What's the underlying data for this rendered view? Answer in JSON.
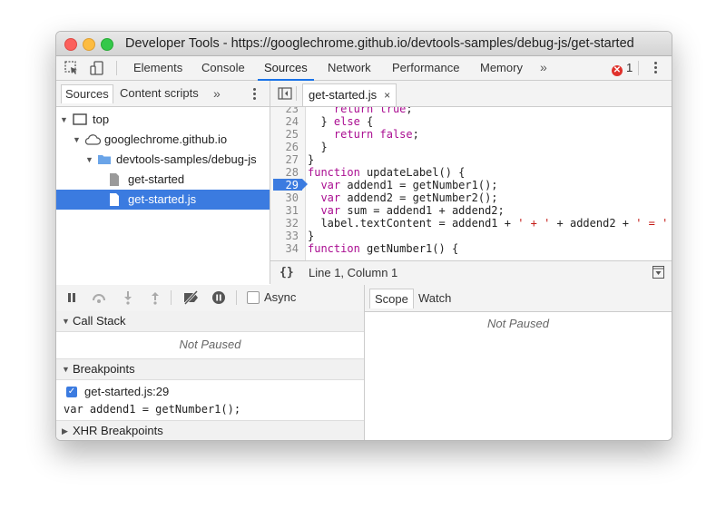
{
  "window": {
    "title": "Developer Tools - https://googlechrome.github.io/devtools-samples/debug-js/get-started"
  },
  "toolbar": {
    "inspect_icon": "inspect-element-icon",
    "device_icon": "device-toolbar-icon",
    "tabs": [
      "Elements",
      "Console",
      "Sources",
      "Network",
      "Performance",
      "Memory"
    ],
    "active_tab": "Sources",
    "more_tabs": "»",
    "error_count": "1",
    "error_glyph": "✕"
  },
  "navigator": {
    "tabs": [
      "Sources",
      "Content scripts"
    ],
    "more": "»",
    "tree": [
      {
        "label": "top",
        "icon": "frame-icon"
      },
      {
        "label": "googlechrome.github.io",
        "icon": "cloud-icon"
      },
      {
        "label": "devtools-samples/debug-js",
        "icon": "folder-icon"
      },
      {
        "label": "get-started",
        "icon": "file-icon"
      },
      {
        "label": "get-started.js",
        "icon": "file-icon",
        "selected": true
      }
    ]
  },
  "editor": {
    "file_tab": "get-started.js",
    "close": "×",
    "line_numbers": [
      "23",
      "24",
      "25",
      "26",
      "27",
      "28",
      "29",
      "30",
      "31",
      "32",
      "33",
      "34"
    ],
    "breakpoint_line": "29",
    "status": {
      "braces": "{}",
      "position": "Line 1, Column 1"
    }
  },
  "debugger": {
    "async_label": "Async",
    "call_stack_title": "Call Stack",
    "call_stack_status": "Not Paused",
    "breakpoints_title": "Breakpoints",
    "breakpoint_file": "get-started.js:29",
    "breakpoint_code": "var addend1 = getNumber1();",
    "xhr_title": "XHR Breakpoints"
  },
  "scope": {
    "tabs": [
      "Scope",
      "Watch"
    ],
    "status": "Not Paused"
  },
  "colors": {
    "accent": "#3b7be0",
    "keyword": "#aa0d91",
    "string": "#c41a16",
    "error": "#e0312b"
  }
}
